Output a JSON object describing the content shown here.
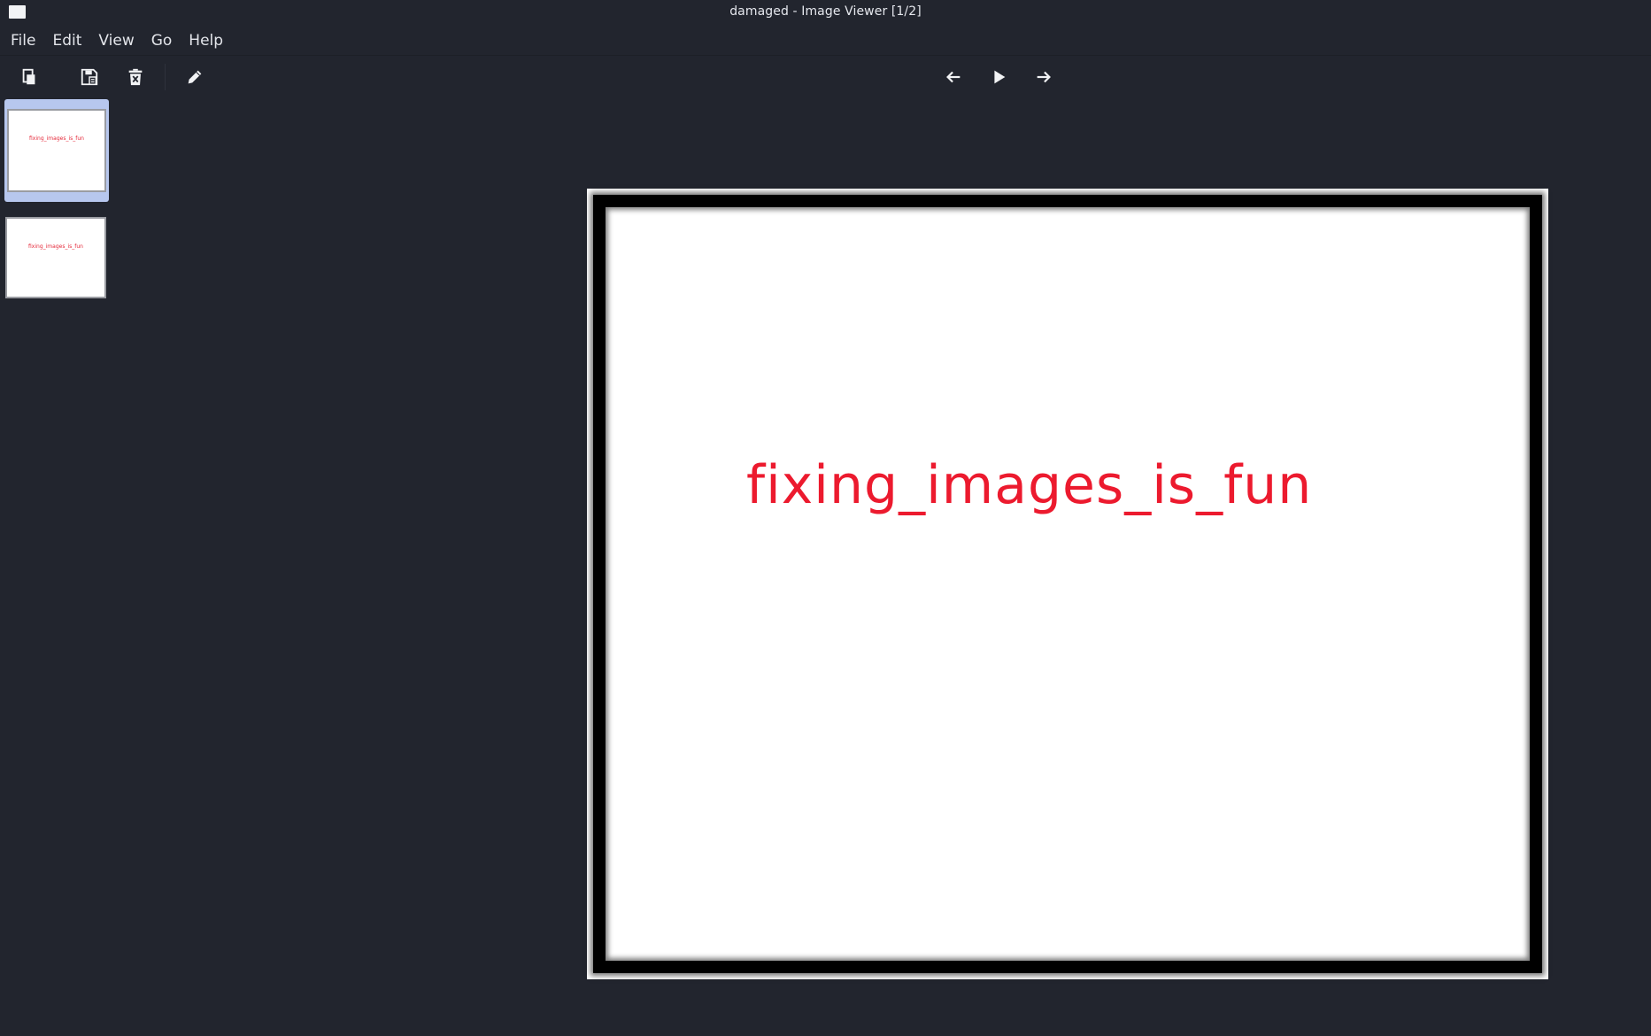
{
  "window": {
    "title": "damaged - Image Viewer [1/2]",
    "icon": "app-window-icon"
  },
  "menu": [
    {
      "label": "File"
    },
    {
      "label": "Edit"
    },
    {
      "label": "View"
    },
    {
      "label": "Go"
    },
    {
      "label": "Help"
    }
  ],
  "toolbar": {
    "left": [
      "copy-icon",
      "save-as-icon",
      "delete-icon",
      "edit-pencil-icon"
    ],
    "center": [
      "arrow-left-icon",
      "play-icon",
      "arrow-right-icon"
    ]
  },
  "thumbnails": [
    {
      "text": "fixing_images_is_fun",
      "selected": true
    },
    {
      "text": "fixing_images_is_fun",
      "selected": false
    }
  ],
  "image": {
    "text": "fixing_images_is_fun",
    "text_color": "#ec1a2e"
  },
  "colors": {
    "background": "#22252e",
    "selection": "#b7c7ee"
  }
}
